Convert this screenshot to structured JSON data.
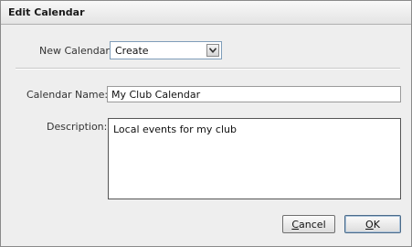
{
  "dialog": {
    "title": "Edit Calendar"
  },
  "new_calendar": {
    "label": "New Calendar:",
    "selected": "Create"
  },
  "calendar_name": {
    "label": "Calendar Name:",
    "value": "My Club Calendar"
  },
  "description": {
    "label": "Description:",
    "value": "Local events for my club"
  },
  "buttons": {
    "cancel": {
      "mnemonic": "C",
      "rest": "ancel"
    },
    "ok": {
      "mnemonic": "O",
      "rest": "K"
    }
  },
  "icons": {
    "dropdown": "chevron-down-icon"
  }
}
